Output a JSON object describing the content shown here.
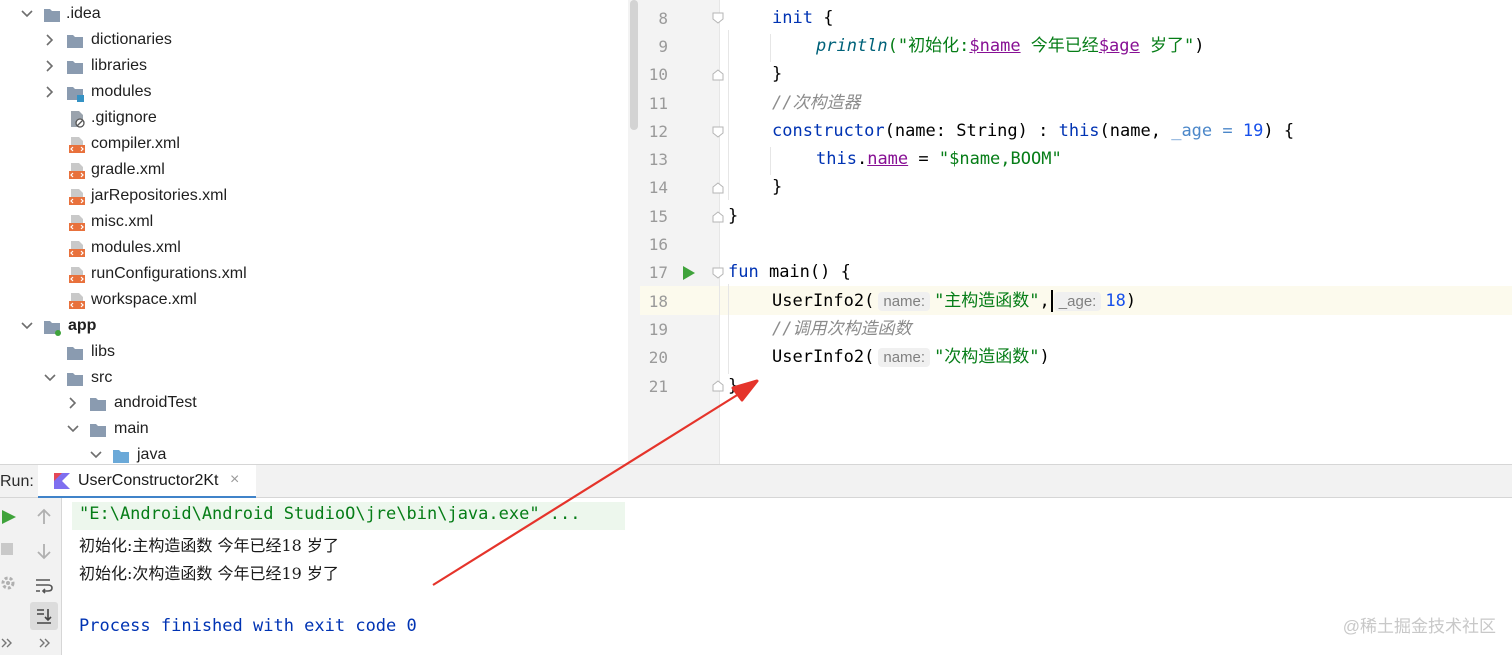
{
  "colors": {
    "folder": "#8a9bb0",
    "folder_src": "#6ba9d8",
    "xml_icon": "#e8713c",
    "keyword": "#0033b3",
    "string": "#067d17",
    "variable": "#871094",
    "comment": "#8c8c8c",
    "number": "#1750eb",
    "annotation_arrow": "#e5342b",
    "run_green": "#3fa33b"
  },
  "project_tree": {
    "items": [
      {
        "label": ".idea",
        "icon": "folder-icon",
        "expanded": true
      },
      {
        "label": "dictionaries",
        "icon": "folder-icon",
        "expanded": false
      },
      {
        "label": "libraries",
        "icon": "folder-icon",
        "expanded": false
      },
      {
        "label": "modules",
        "icon": "folder-module-icon",
        "expanded": false
      },
      {
        "label": ".gitignore",
        "icon": "gitignore-file-icon"
      },
      {
        "label": "compiler.xml",
        "icon": "xml-file-icon"
      },
      {
        "label": "gradle.xml",
        "icon": "xml-file-icon"
      },
      {
        "label": "jarRepositories.xml",
        "icon": "xml-file-icon"
      },
      {
        "label": "misc.xml",
        "icon": "xml-file-icon"
      },
      {
        "label": "modules.xml",
        "icon": "xml-file-icon"
      },
      {
        "label": "runConfigurations.xml",
        "icon": "xml-file-icon"
      },
      {
        "label": "workspace.xml",
        "icon": "xml-file-icon"
      },
      {
        "label": "app",
        "icon": "module-folder-icon",
        "expanded": true
      },
      {
        "label": "libs",
        "icon": "folder-icon"
      },
      {
        "label": "src",
        "icon": "folder-icon",
        "expanded": true
      },
      {
        "label": "androidTest",
        "icon": "folder-icon",
        "expanded": false
      },
      {
        "label": "main",
        "icon": "folder-icon",
        "expanded": true
      },
      {
        "label": "java",
        "icon": "source-folder-icon",
        "expanded": true
      }
    ]
  },
  "editor": {
    "line_numbers": [
      "8",
      "9",
      "10",
      "11",
      "12",
      "13",
      "14",
      "15",
      "16",
      "17",
      "18",
      "19",
      "20",
      "21"
    ],
    "l8_kw": "init",
    "l8_rest": " {",
    "l9_fn": "println",
    "l9_s1": "(\"初始化:",
    "l9_v1": "$name",
    "l9_s2": " 今年已经",
    "l9_v2": "$age",
    "l9_s3": " 岁了\"",
    "l9_end": ")",
    "l10": "}",
    "l11_comment": "//次构造器",
    "l12_kw": "constructor",
    "l12_a": "(name: String) : ",
    "l12_this": "this",
    "l12_b": "(name, ",
    "l12_param": "_age = ",
    "l12_num": "19",
    "l12_c": ") {",
    "l13_this": "this",
    "l13_dot": ".",
    "l13_var": "name",
    "l13_eq": " = ",
    "l13_str": "\"$name,BOOM\"",
    "l14": "}",
    "l15": "}",
    "l17_kw": "fun",
    "l17_rest": " main() {",
    "l18_call": "UserInfo2(",
    "l18_hint1": "name:",
    "l18_str": "\"主构造函数\"",
    "l18_comma": ",",
    "l18_hint2": "_age:",
    "l18_num": "18",
    "l18_end": ")",
    "l19_comment": "//调用次构造函数",
    "l20_call": "UserInfo2(",
    "l20_hint": "name:",
    "l20_str": "\"次构造函数\"",
    "l20_end": ")",
    "l21": "}"
  },
  "run_panel": {
    "label": "Run:",
    "tab_label": "UserConstructor2Kt",
    "tab_close": "×",
    "toolbar": [
      "run-icon",
      "stop-icon",
      "settings-icon",
      "up-arrow-icon",
      "down-arrow-icon",
      "soft-wrap-icon",
      "scroll-to-end-icon",
      "more-icon"
    ]
  },
  "console": {
    "command": "\"E:\\Android\\Android StudioO\\jre\\bin\\java.exe\" ...",
    "output_1": "初始化:主构造函数 今年已经18 岁了",
    "output_2": "初始化:次构造函数 今年已经19 岁了",
    "exit_message": "Process finished with exit code 0"
  },
  "watermark": "@稀土掘金技术社区"
}
